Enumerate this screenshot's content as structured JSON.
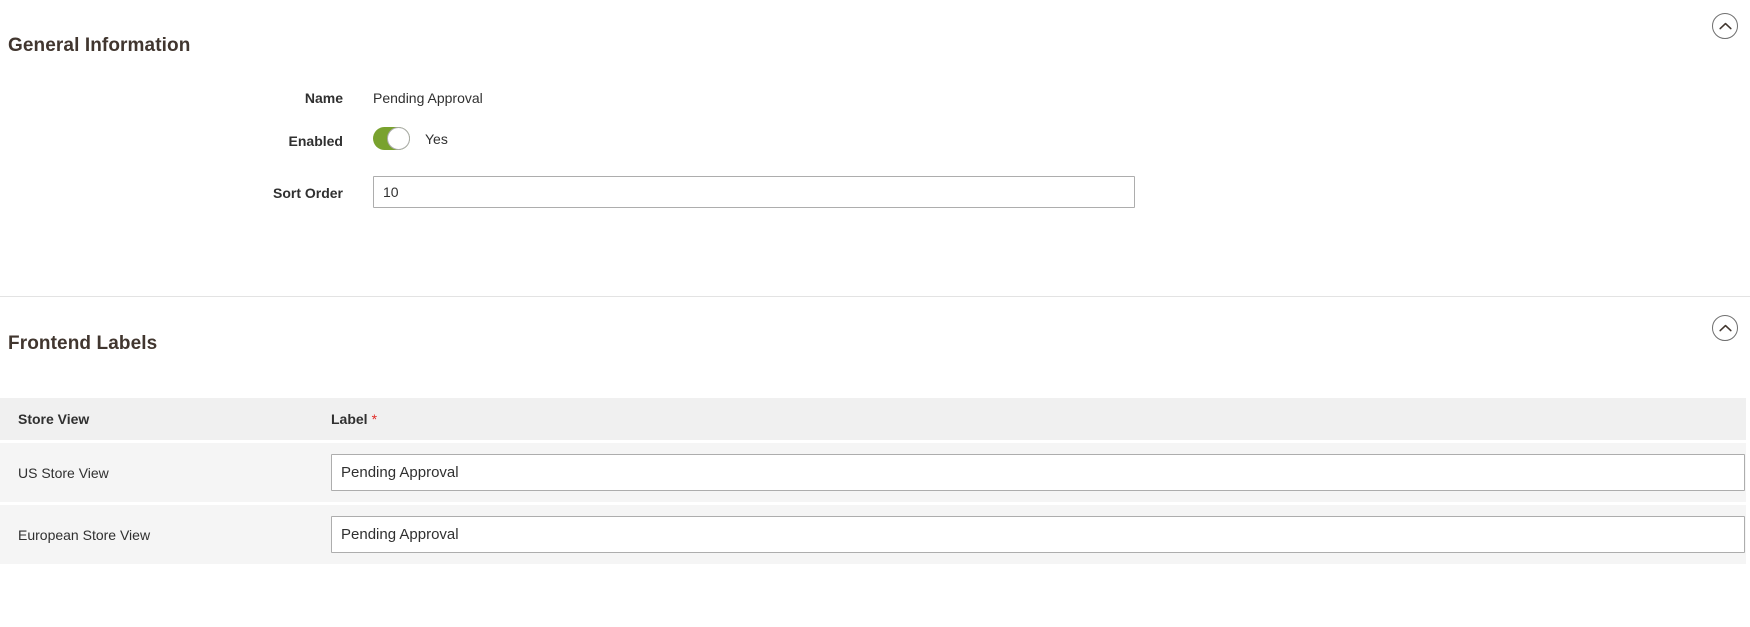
{
  "sections": {
    "general": {
      "title": "General Information",
      "collapse_icon": "chevron-up-circle-icon",
      "fields": {
        "name": {
          "label": "Name",
          "value": "Pending Approval"
        },
        "enabled": {
          "label": "Enabled",
          "state_text": "Yes",
          "state_on": true,
          "on_color": "#79a22e"
        },
        "sort_order": {
          "label": "Sort Order",
          "value": "10",
          "placeholder": ""
        }
      }
    },
    "frontend_labels": {
      "title": "Frontend Labels",
      "collapse_icon": "chevron-up-circle-icon",
      "table": {
        "columns": {
          "store_view": "Store View",
          "label": "Label",
          "label_required_marker": "*",
          "required_color": "#e02b27"
        },
        "rows": [
          {
            "store_view": "US Store View",
            "label_value": "Pending Approval",
            "label_placeholder": ""
          },
          {
            "store_view": "European Store View",
            "label_value": "Pending Approval",
            "label_placeholder": ""
          }
        ]
      }
    }
  }
}
